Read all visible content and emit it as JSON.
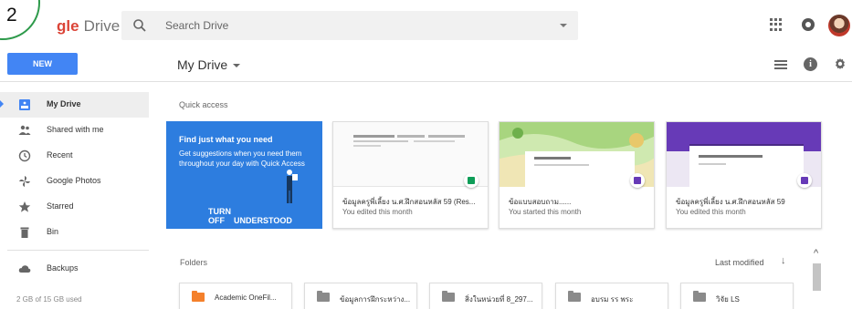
{
  "tutorial": {
    "step": "2"
  },
  "header": {
    "logo_fragment": "gle",
    "logo_product": "Drive",
    "search_placeholder": "Search Drive"
  },
  "toolbar": {
    "new_label": "NEW",
    "location_title": "My Drive"
  },
  "sidebar": {
    "items": [
      {
        "label": "My Drive",
        "icon": "my-drive-icon",
        "active": true
      },
      {
        "label": "Shared with me",
        "icon": "people-icon",
        "active": false
      },
      {
        "label": "Recent",
        "icon": "clock-icon",
        "active": false
      },
      {
        "label": "Google Photos",
        "icon": "pinwheel-icon",
        "active": false
      },
      {
        "label": "Starred",
        "icon": "star-icon",
        "active": false
      },
      {
        "label": "Bin",
        "icon": "trash-icon",
        "active": false
      }
    ],
    "backups_label": "Backups",
    "storage": "2 GB of 15 GB used"
  },
  "quick_access": {
    "label": "Quick access",
    "promo": {
      "title": "Find just what you need",
      "body": "Get suggestions when you need them throughout your day with Quick Access",
      "dismiss_label": "TURN OFF",
      "accept_label": "UNDERSTOOD"
    },
    "cards": [
      {
        "title": "ข้อมูลครูพี่เลี้ยง น.ศ.ฝึกสอนหลัส 59 (Res...",
        "subtitle": "You edited this month",
        "type": "sheet"
      },
      {
        "title": "ข้อแบบสอบถาม......",
        "subtitle": "You started this month",
        "type": "form"
      },
      {
        "title": "ข้อมูลครูพี่เลี้ยง น.ศ.ฝึกสอนหลัส 59",
        "subtitle": "You edited this month",
        "type": "form"
      }
    ]
  },
  "folders": {
    "label": "Folders",
    "sort_label": "Last modified",
    "items": [
      {
        "label": "Academic OneFil...",
        "color": "#f4802b"
      },
      {
        "label": "ข้อมูลการฝึกระหว่าง...",
        "color": "#8a8a8a"
      },
      {
        "label": "สิ่งในหน่วยที่ 8_297...",
        "color": "#8a8a8a"
      },
      {
        "label": "อบรม รร พระ",
        "color": "#8a8a8a"
      },
      {
        "label": "วิจัย LS",
        "color": "#8a8a8a"
      }
    ]
  },
  "colors": {
    "primary_blue": "#4285f4",
    "promo_blue": "#2d7ddf",
    "form_purple": "#673ab7",
    "sheet_green": "#0f9d58"
  }
}
